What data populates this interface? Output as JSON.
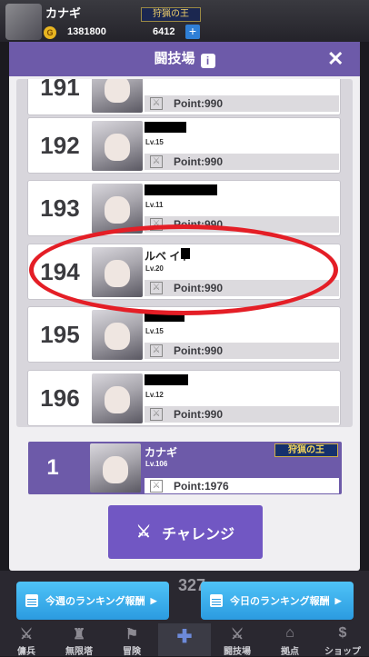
{
  "player": {
    "name": "カナギ",
    "title": "狩猟の王",
    "gold": "1381800",
    "gems": "6412",
    "plus": "+"
  },
  "modal": {
    "title": "闘技場",
    "info_glyph": "i",
    "close_glyph": "✕"
  },
  "ranking": [
    {
      "rank": "191",
      "name": "",
      "level": "",
      "point": "Point:990"
    },
    {
      "rank": "192",
      "name": "",
      "level": "Lv.15",
      "point": "Point:990"
    },
    {
      "rank": "193",
      "name": "",
      "level": "Lv.11",
      "point": "Point:990"
    },
    {
      "rank": "194",
      "name": "ルベ  イト",
      "level": "Lv.20",
      "point": "Point:990"
    },
    {
      "rank": "195",
      "name": "",
      "level": "Lv.15",
      "point": "Point:990"
    },
    {
      "rank": "196",
      "name": "",
      "level": "Lv.12",
      "point": "Point:990"
    }
  ],
  "my_rank": {
    "rank": "1",
    "name": "カナギ",
    "level": "Lv.106",
    "title": "狩猟の王",
    "point": "Point:1976"
  },
  "challenge_label": "チャレンジ",
  "weekly_reward": "今週のランキング報酬",
  "daily_reward": "今日のランキング報酬",
  "background_number": "327",
  "nav": [
    "傭兵",
    "無限塔",
    "冒険",
    "",
    "闘技場",
    "拠点",
    "ショップ"
  ],
  "colors": {
    "accent": "#6d5aa9",
    "button": "#7157c3",
    "reward": "#2b9be0",
    "highlight": "#e41e26"
  }
}
